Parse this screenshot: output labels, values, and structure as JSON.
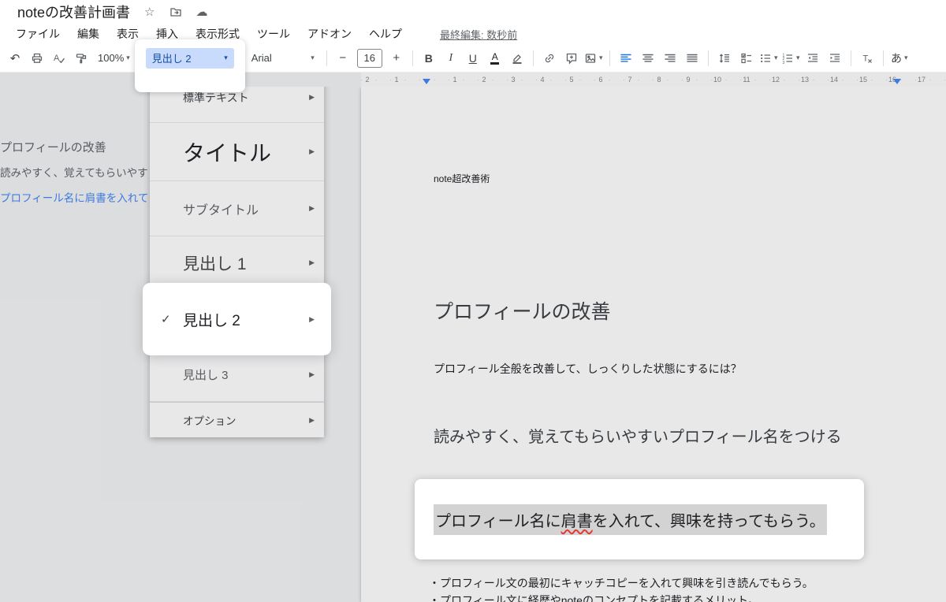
{
  "header": {
    "doc_title": "noteの改善計画書"
  },
  "menubar": {
    "items": [
      "ファイル",
      "編集",
      "表示",
      "挿入",
      "表示形式",
      "ツール",
      "アドオン",
      "ヘルプ"
    ],
    "last_edited": "最終編集: 数秒前"
  },
  "toolbar": {
    "zoom": "100%",
    "style_selected": "見出し 2",
    "font": "Arial",
    "font_size": "16",
    "input_tool": "あ"
  },
  "ruler": {
    "left_numbers": [
      "2",
      "1"
    ],
    "numbers": [
      "1",
      "2",
      "3",
      "4",
      "5",
      "6",
      "7",
      "8",
      "9",
      "10",
      "11",
      "12",
      "13",
      "14",
      "15",
      "16",
      "17"
    ]
  },
  "styles_menu": {
    "items": [
      {
        "label": "標準テキスト",
        "checked": false
      },
      {
        "label": "タイトル",
        "checked": false
      },
      {
        "label": "サブタイトル",
        "checked": false
      },
      {
        "label": "見出し 1",
        "checked": false
      },
      {
        "label": "見出し 2",
        "checked": true
      },
      {
        "label": "見出し 3",
        "checked": false
      }
    ],
    "options_label": "オプション"
  },
  "outline_panel": {
    "items": [
      {
        "text": "プロフィールの改善"
      },
      {
        "text": "読みやすく、覚えてもらいやす"
      },
      {
        "text": "プロフィール名に肩書を入れて"
      }
    ]
  },
  "document": {
    "body_label": "note超改善術",
    "heading1": "プロフィールの改善",
    "para1": "プロフィール全般を改善して、しっくりした状態にするには？",
    "heading2": "読みやすく、覚えてもらいやすいプロフィール名をつける",
    "selected_before": "プロフィール名に",
    "selected_misspell": "肩書",
    "selected_after": "を入れて、興味を持ってもらう。",
    "bullet1": "・プロフィール文の最初にキャッチコピーを入れて興味を引き読んでもらう。",
    "bullet2": "・プロフィール文に経歴やnoteのコンセプトを記載するメリット。"
  },
  "icons": {
    "star": "☆",
    "cloud": "☁",
    "undo": "↶",
    "caret_down": "▾",
    "submenu_arrow": "▶",
    "check": "✓",
    "minus": "−",
    "plus": "+",
    "bold": "B",
    "italic": "I",
    "underline": "U",
    "text_color_letter": "A"
  },
  "colors": {
    "accent_blue": "#1a73e8",
    "style_chip_bg": "#c8dbfc",
    "style_chip_text": "#174ea6",
    "selection_bg": "#d3d3d3",
    "spellcheck_red": "#e53935",
    "dim_overlay": "rgba(32,33,36,0.10)"
  }
}
